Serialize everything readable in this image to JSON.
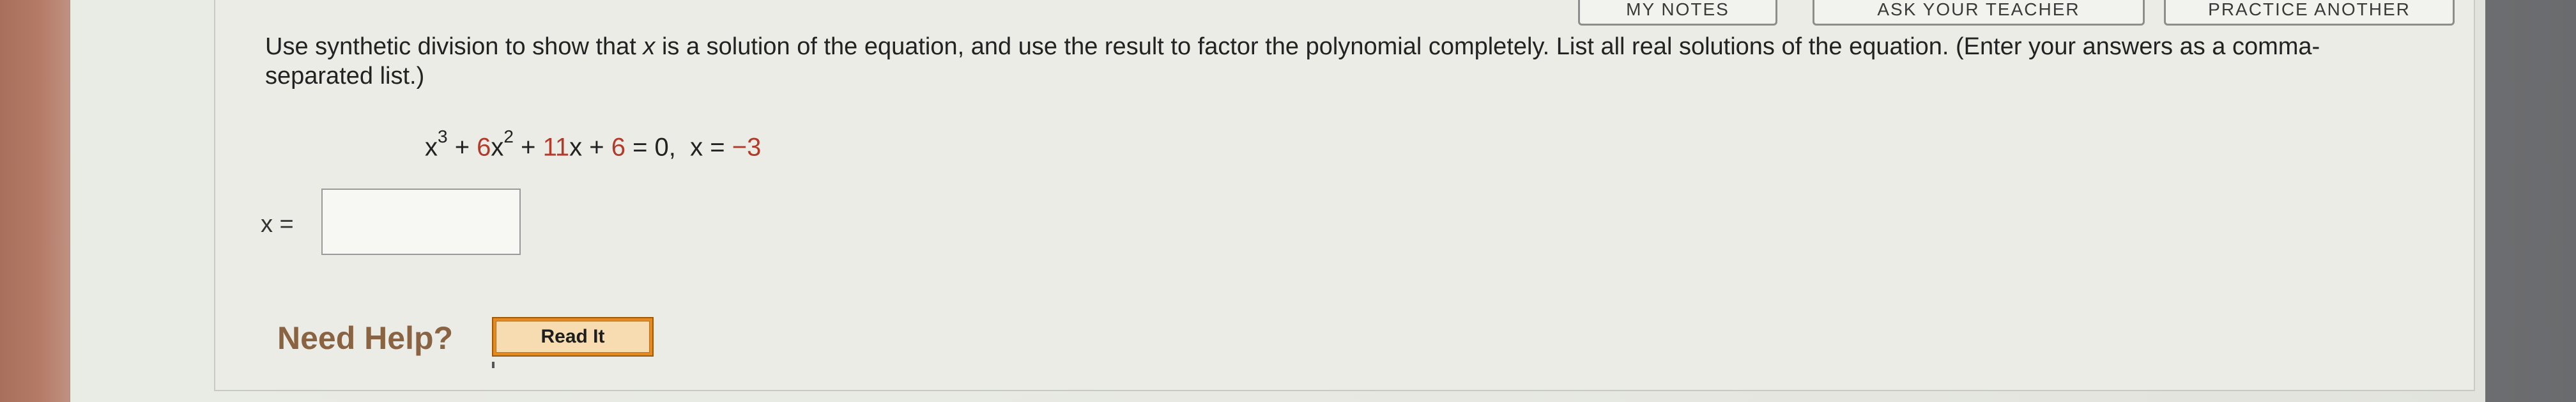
{
  "toolbar": {
    "left_button_label": "MY NOTES",
    "ask_teacher_label": "ASK YOUR TEACHER",
    "practice_another_label": "PRACTICE ANOTHER"
  },
  "question": {
    "part1": "Use synthetic division to show that ",
    "var": "x",
    "part2": " is a solution of the equation, and use the result to factor the polynomial completely. List all real solutions of the equation. (Enter your answers as a comma-separated list.)"
  },
  "equation": {
    "x3": "x",
    "exp3": "3",
    "plus1": " + ",
    "coef6": "6",
    "x2": "x",
    "exp2": "2",
    "plus2": " + ",
    "coef11": "11",
    "x1": "x + ",
    "const6": "6",
    "rest": " = 0,  x = ",
    "root": "−3"
  },
  "answer": {
    "label": "x =",
    "value": ""
  },
  "help": {
    "label": "Need Help?",
    "read_it": "Read It"
  }
}
